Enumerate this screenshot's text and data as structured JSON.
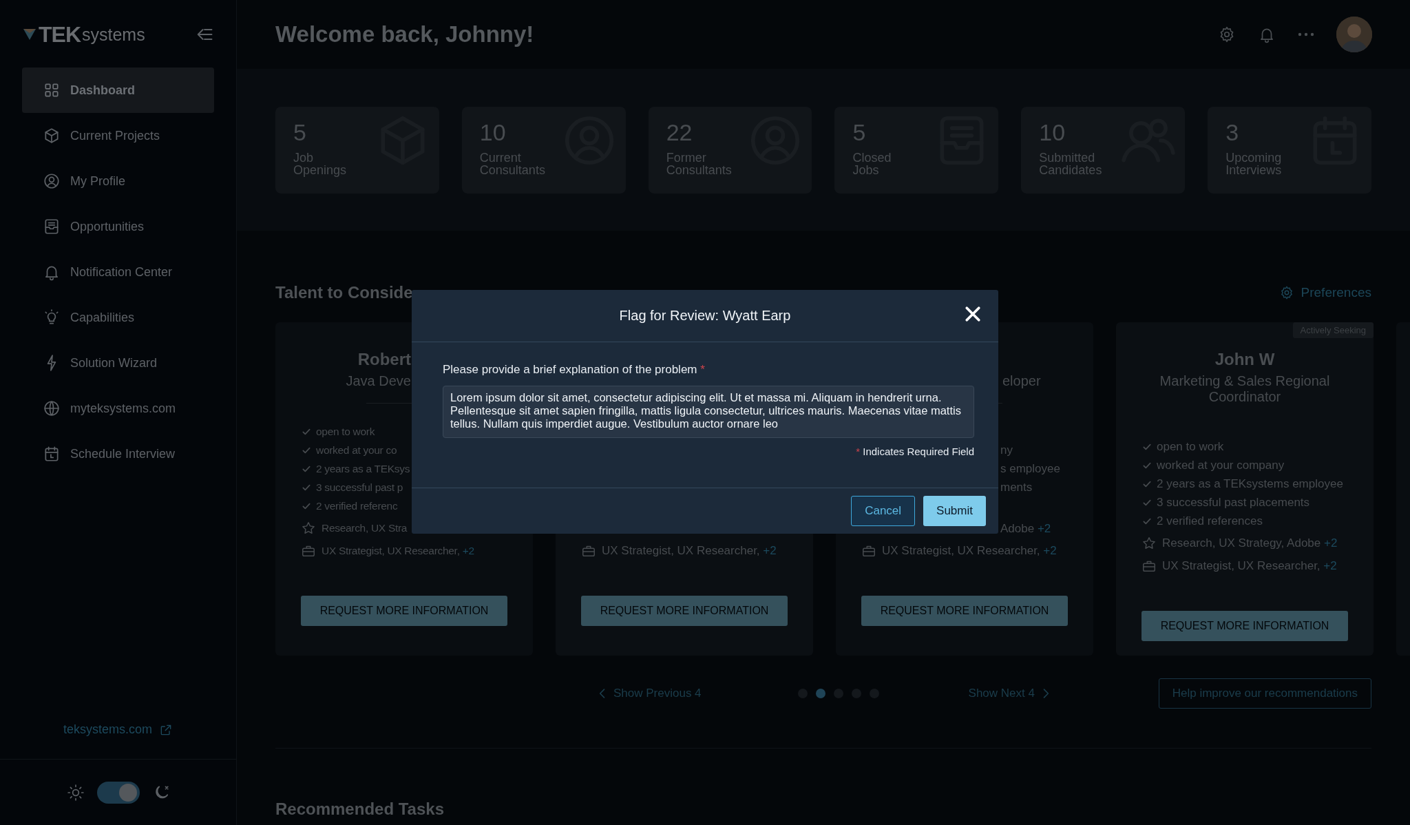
{
  "sidebar": {
    "logo_brand": "TEK",
    "logo_suffix": "systems",
    "items": [
      {
        "label": "Dashboard",
        "selected": true
      },
      {
        "label": "Current Projects",
        "selected": false
      },
      {
        "label": "My Profile",
        "selected": false
      },
      {
        "label": "Opportunities",
        "selected": false
      },
      {
        "label": "Notification Center",
        "selected": false
      },
      {
        "label": "Capabilities",
        "selected": false
      },
      {
        "label": "Solution Wizard",
        "selected": false
      },
      {
        "label": "myteksystems.com",
        "selected": false
      },
      {
        "label": "Schedule Interview",
        "selected": false
      }
    ],
    "footer_link": "teksystems.com",
    "dark_mode": true
  },
  "header": {
    "title": "Welcome back, Johnny!"
  },
  "stats": [
    {
      "value": "5",
      "label": "Job Openings"
    },
    {
      "value": "10",
      "label": "Current Consultants"
    },
    {
      "value": "22",
      "label": "Former Consultants"
    },
    {
      "value": "5",
      "label": "Closed Jobs"
    },
    {
      "value": "10",
      "label": "Submitted Candidates"
    },
    {
      "value": "3",
      "label": "Upcoming Interviews"
    }
  ],
  "talent": {
    "title": "Talent to Conside",
    "preferences": "Preferences",
    "cards": [
      {
        "name": "Robert",
        "title": "Java Deve",
        "checks": [
          "open to work",
          "worked at your co",
          "2 years as a TEKsys",
          "3 successful past p",
          "2 verified referenc"
        ],
        "skills": {
          "text": "Research, UX Stra"
        },
        "roles": {
          "text": "UX Strategist, UX Researcher,",
          "more": "+2"
        },
        "button": "REQUEST MORE INFORMATION"
      },
      {
        "roles": {
          "text": "UX Strategist, UX Researcher,",
          "more": "+2"
        },
        "button": "REQUEST MORE INFORMATION"
      },
      {
        "title": "eloper",
        "checks": [
          "ny",
          "s employee",
          "ments"
        ],
        "skills": {
          "text": "Adobe",
          "more": "+2"
        },
        "roles": {
          "text": "UX Strategist, UX Researcher,",
          "more": "+2"
        },
        "button": "REQUEST MORE INFORMATION"
      },
      {
        "badge": "Actively Seeking",
        "name": "John W",
        "title": "Marketing & Sales Regional Coordinator",
        "checks": [
          "open to work",
          "worked at your company",
          "2 years as a TEKsystems employee",
          "3 successful past placements",
          "2 verified references"
        ],
        "skills": {
          "text": "Research, UX Strategy, Adobe",
          "more": "+2"
        },
        "roles": {
          "text": "UX Strategist, UX Researcher,",
          "more": "+2"
        },
        "button": "REQUEST MORE INFORMATION"
      }
    ],
    "pagination": {
      "previous": "Show Previous 4",
      "next": "Show Next 4",
      "dots": [
        {
          "selected": false
        },
        {
          "selected": true
        },
        {
          "selected": false
        },
        {
          "selected": false
        },
        {
          "selected": false
        }
      ]
    },
    "help_button": "Help improve our recommendations"
  },
  "recommended": {
    "title": "Recommended Tasks"
  },
  "modal": {
    "title": "Flag for Review: Wyatt Earp",
    "label": "Please provide a brief explanation of the problem",
    "required_mark": "*",
    "value": "Lorem ipsum dolor sit amet, consectetur adipiscing elit. Ut et massa mi. Aliquam in hendrerit urna. Pellentesque sit amet sapien fringilla, mattis ligula consectetur, ultrices mauris. Maecenas vitae mattis tellus. Nullam quis imperdiet augue. Vestibulum auctor ornare leo",
    "required_note": "Indicates Required Field",
    "buttons": [
      {
        "label": "Cancel",
        "kind": "secondary"
      },
      {
        "label": "Submit",
        "kind": "primary"
      }
    ]
  }
}
